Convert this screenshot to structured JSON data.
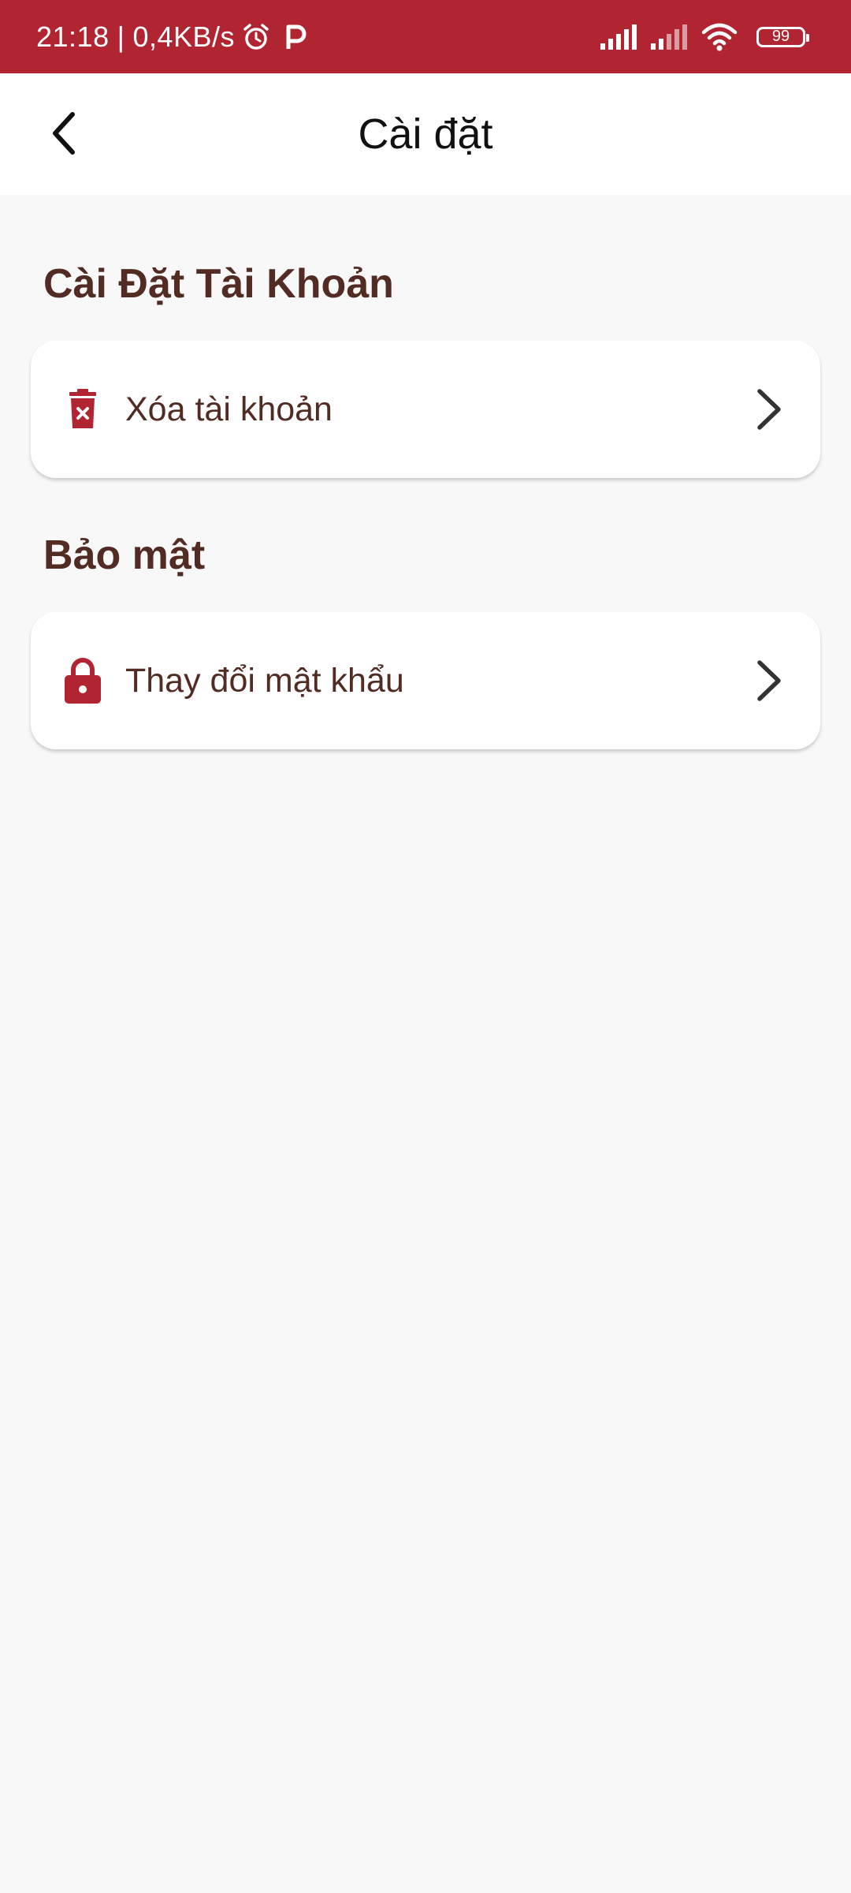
{
  "status_bar": {
    "time": "21:18",
    "separator": "|",
    "network_speed": "0,4KB/s",
    "battery_level": "99",
    "icons": [
      "alarm-icon",
      "p-app-icon",
      "signal-icon",
      "signal-icon",
      "wifi-icon",
      "battery-icon"
    ],
    "background_color": "#b02531"
  },
  "app_bar": {
    "title": "Cài đặt",
    "back_icon": "chevron-left-icon"
  },
  "sections": [
    {
      "title": "Cài Đặt Tài Khoản",
      "items": [
        {
          "label": "Xóa tài khoản",
          "icon": "trash-delete-icon"
        }
      ]
    },
    {
      "title": "Bảo mật",
      "items": [
        {
          "label": "Thay đổi mật khẩu",
          "icon": "lock-icon"
        }
      ]
    }
  ],
  "colors": {
    "accent": "#b02531",
    "text_brown": "#522b23",
    "background": "#f8f8f8"
  }
}
